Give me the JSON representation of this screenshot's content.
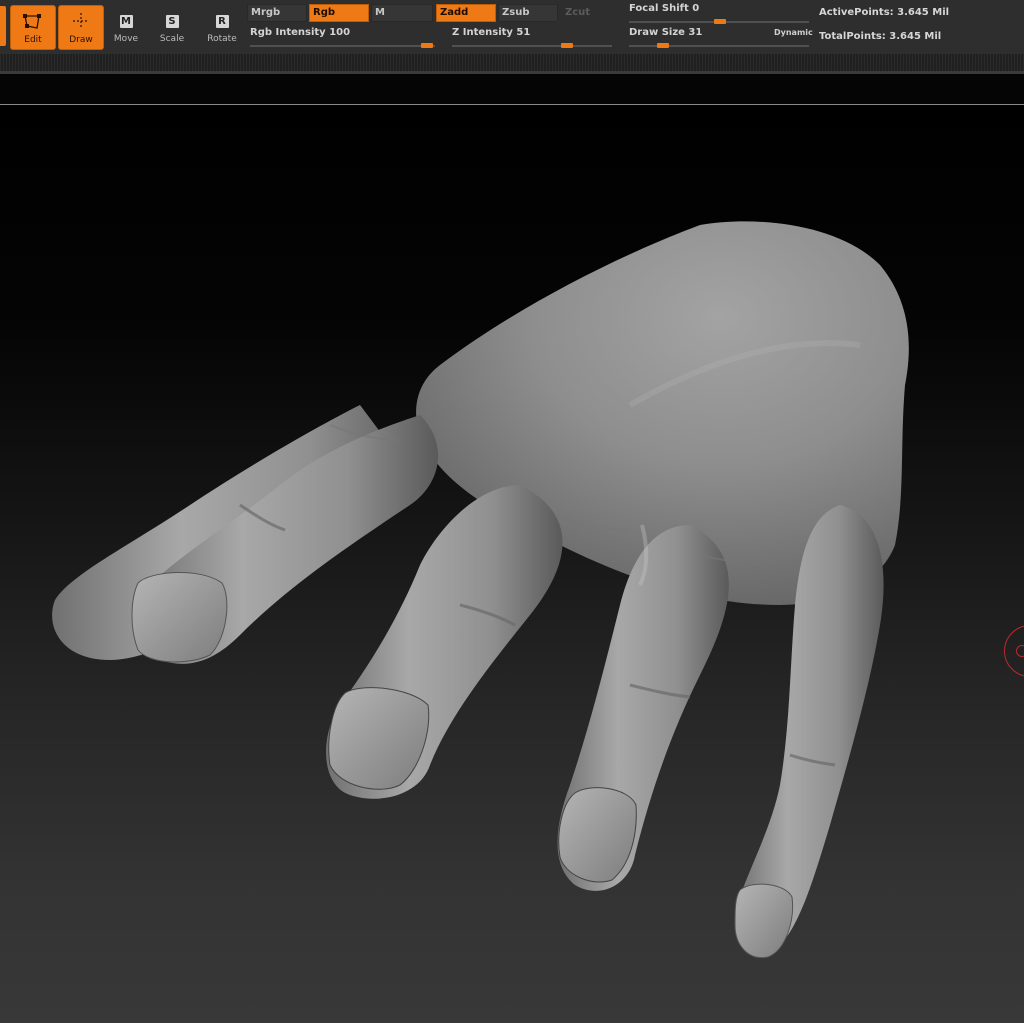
{
  "toolbar": {
    "tools": [
      {
        "label": "Edit",
        "icon": "edit-icon",
        "active": true
      },
      {
        "label": "Draw",
        "icon": "draw-icon",
        "active": true
      },
      {
        "label": "Move",
        "icon": "move-icon",
        "key": "M",
        "active": false
      },
      {
        "label": "Scale",
        "icon": "scale-icon",
        "key": "S",
        "active": false
      },
      {
        "label": "Rotate",
        "icon": "rotate-icon",
        "key": "R",
        "active": false
      }
    ],
    "color_modes": {
      "mrgb": "Mrgb",
      "rgb": "Rgb",
      "m": "M"
    },
    "depth_modes": {
      "zadd": "Zadd",
      "zsub": "Zsub",
      "zcut": "Zcut"
    },
    "sliders": {
      "rgb_intensity": {
        "label": "Rgb Intensity",
        "value": 100
      },
      "z_intensity": {
        "label": "Z Intensity",
        "value": 51
      },
      "focal_shift": {
        "label": "Focal Shift",
        "value": 0
      },
      "draw_size": {
        "label": "Draw Size",
        "value": 31
      }
    },
    "dynamic_label": "Dynamic",
    "stats": {
      "active_points": "ActivePoints: 3.645  Mil",
      "total_points": "TotalPoints: 3.645  Mil"
    },
    "accent_color": "#ef7a15"
  },
  "viewport": {
    "model": "hand-sculpt",
    "cursor_color": "#c0282a"
  }
}
